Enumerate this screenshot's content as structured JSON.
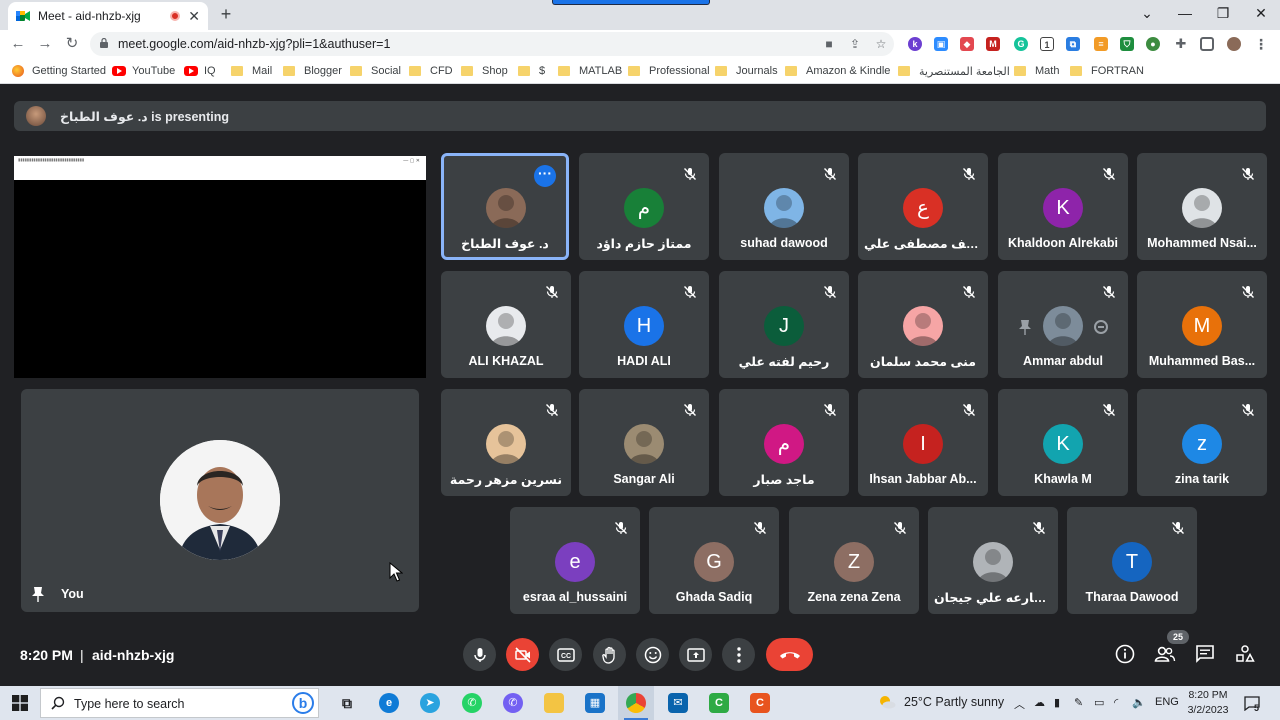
{
  "browser": {
    "tab_title": "Meet - aid-nhzb-xjg",
    "url": "meet.google.com/aid-nhzb-xjg?pli=1&authuser=1",
    "bookmarks": [
      {
        "label": "Getting Started",
        "icon": "firefox"
      },
      {
        "label": "YouTube",
        "icon": "youtube"
      },
      {
        "label": "IQ",
        "icon": "youtube"
      },
      {
        "label": "Mail",
        "icon": "folder"
      },
      {
        "label": "Blogger",
        "icon": "folder"
      },
      {
        "label": "Social",
        "icon": "folder"
      },
      {
        "label": "CFD",
        "icon": "folder"
      },
      {
        "label": "Shop",
        "icon": "folder"
      },
      {
        "label": "$",
        "icon": "folder"
      },
      {
        "label": "MATLAB",
        "icon": "folder"
      },
      {
        "label": "Professional",
        "icon": "folder"
      },
      {
        "label": "Journals",
        "icon": "folder"
      },
      {
        "label": "Amazon & Kindle",
        "icon": "folder"
      },
      {
        "label": "الجامعة المستنصرية",
        "icon": "folder"
      },
      {
        "label": "Math",
        "icon": "folder"
      },
      {
        "label": "FORTRAN",
        "icon": "folder"
      }
    ]
  },
  "meet": {
    "presenting_banner": "د. عوف الطباخ is presenting",
    "self_name": "You",
    "participants": [
      {
        "name": "د. عوف الطباخ",
        "initial": "",
        "color": "#8a6a58",
        "photo": true,
        "active": true
      },
      {
        "name": "ممتاز حازم داؤد",
        "initial": "م",
        "color": "#188038"
      },
      {
        "name": "suhad dawood",
        "initial": "",
        "color": "#7fb5e6",
        "photo": true
      },
      {
        "name": "عواطف مصطفى علي",
        "initial": "ع",
        "color": "#d93025"
      },
      {
        "name": "Khaldoon Alrekabi",
        "initial": "K",
        "color": "#8e24aa"
      },
      {
        "name": "Mohammed Nsai...",
        "initial": "",
        "color": "#dfe3e6",
        "photo": true
      },
      {
        "name": "ALI KHAZAL",
        "initial": "",
        "color": "#e8eaed",
        "photo": true
      },
      {
        "name": "HADI ALI",
        "initial": "H",
        "color": "#1a73e8"
      },
      {
        "name": "رحيم لفته علي",
        "initial": "J",
        "color": "#0b5d3b"
      },
      {
        "name": "منى محمد سلمان",
        "initial": "",
        "color": "#f6a5a5",
        "photo": true
      },
      {
        "name": "Ammar abdul",
        "initial": "",
        "color": "#7d8c9a",
        "photo": true
      },
      {
        "name": "Muhammed Bas...",
        "initial": "M",
        "color": "#e8710a"
      },
      {
        "name": "نسرين مزهر رحمة",
        "initial": "",
        "color": "#e6c39a",
        "photo": true
      },
      {
        "name": "Sangar Ali",
        "initial": "",
        "color": "#9b8b72",
        "photo": true
      },
      {
        "name": "ماجد صبار",
        "initial": "م",
        "color": "#d01884"
      },
      {
        "name": "Ihsan Jabbar Ab...",
        "initial": "I",
        "color": "#c5221f"
      },
      {
        "name": "Khawla M",
        "initial": "K",
        "color": "#12a4af"
      },
      {
        "name": "zina tarik",
        "initial": "z",
        "color": "#1e88e5"
      },
      {
        "name": "esraa al_hussaini",
        "initial": "e",
        "color": "#7b3fbf"
      },
      {
        "name": "Ghada Sadiq",
        "initial": "G",
        "color": "#8d6e63"
      },
      {
        "name": "Zena zena Zena",
        "initial": "Z",
        "color": "#8d6e63"
      },
      {
        "name": "ا.م.د. فارعه علي جيجان",
        "initial": "",
        "color": "#b0b4b8",
        "photo": true
      },
      {
        "name": "Tharaa Dawood",
        "initial": "T",
        "color": "#1565c0"
      }
    ],
    "bottom": {
      "time": "8:20 PM",
      "separator": "|",
      "meeting_code": "aid-nhzb-xjg",
      "participants_count": "25"
    }
  },
  "taskbar": {
    "search_placeholder": "Type here to search",
    "weather": "25°C  Partly sunny",
    "language": "ENG",
    "time": "8:20 PM",
    "date": "3/2/2023",
    "notifications": "5"
  }
}
